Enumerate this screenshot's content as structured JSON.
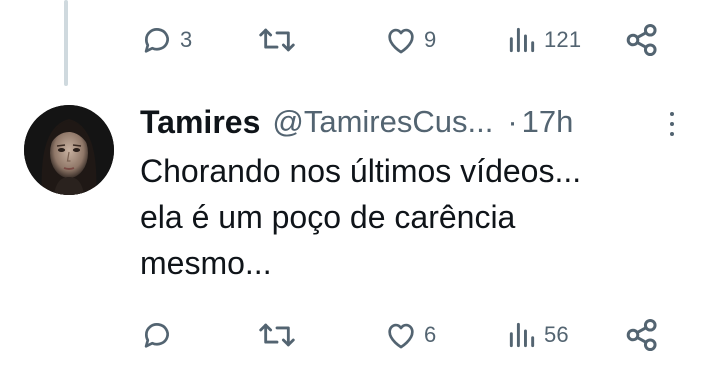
{
  "previous_tweet": {
    "actions": {
      "replies": "3",
      "retweets": "",
      "likes": "9",
      "views": "121"
    }
  },
  "tweet": {
    "author_name": "Tamires",
    "author_handle": "@TamiresCus...",
    "separator": "·",
    "timestamp": "17h",
    "text_lines": [
      "Chorando nos últimos vídeos...",
      "ela é um poço de carência",
      "mesmo..."
    ],
    "actions": {
      "replies": "",
      "retweets": "",
      "likes": "6",
      "views": "56"
    }
  },
  "icons": {
    "reply": "reply-icon",
    "retweet": "retweet-icon",
    "like": "heart-icon",
    "views": "views-icon",
    "share": "share-icon",
    "more": "more-options-icon"
  },
  "colors": {
    "text_primary": "#0f1419",
    "text_secondary": "#536471",
    "thread_line": "#cfd9de"
  }
}
